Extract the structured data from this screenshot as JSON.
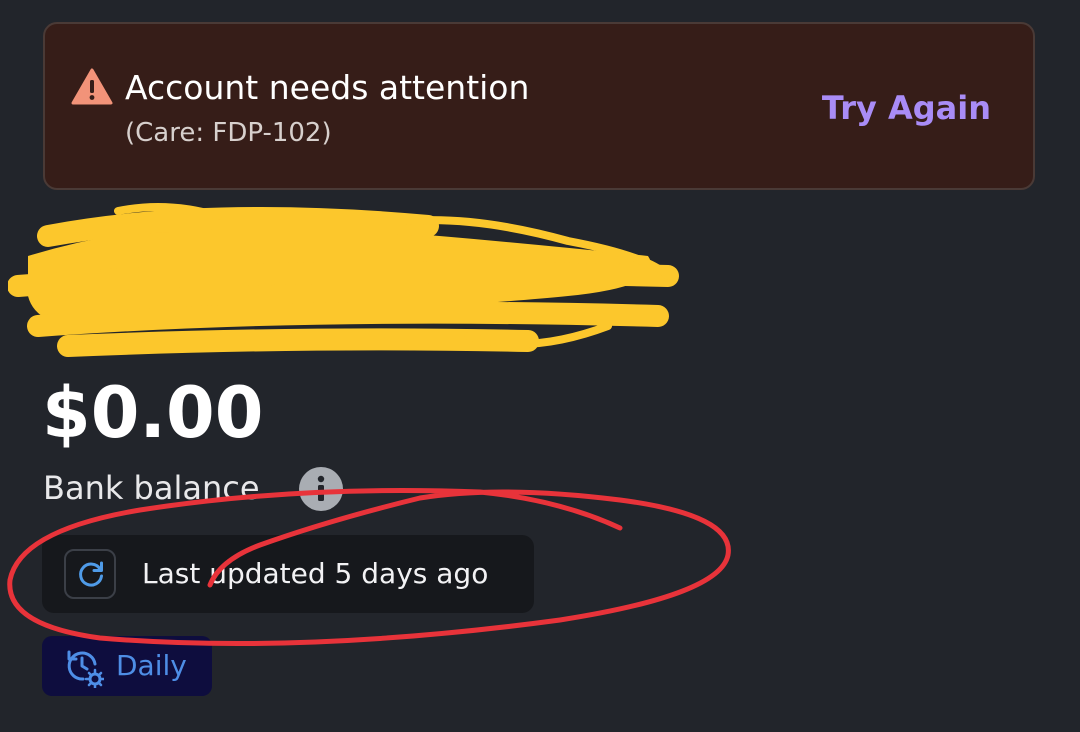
{
  "alert": {
    "icon": "warning-triangle-icon",
    "title": "Account needs attention",
    "subtitle": "(Care: FDP-102)",
    "action_label": "Try Again",
    "accent_color": "#a98cf6",
    "background_color": "#361d18"
  },
  "account": {
    "balance": "$0.00",
    "balance_label": "Bank balance",
    "info_icon": "info-icon"
  },
  "sync": {
    "icon": "refresh-icon",
    "status_text": "Last updated 5 days ago"
  },
  "schedule": {
    "icon": "clock-settings-icon",
    "label": "Daily"
  },
  "annotations": {
    "redaction_color": "#fcc72c",
    "circle_color": "#e8333a"
  }
}
